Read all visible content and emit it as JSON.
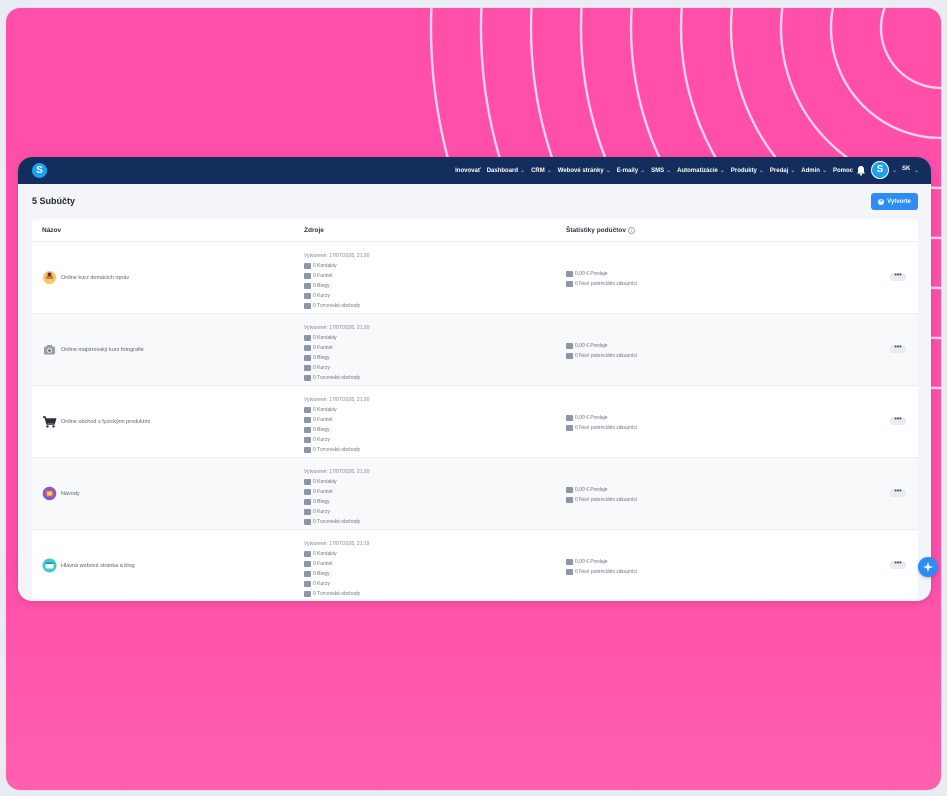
{
  "navbar": {
    "items": [
      {
        "label": "Inovovať",
        "chevron": false
      },
      {
        "label": "Dashboard",
        "chevron": true
      },
      {
        "label": "CRM",
        "chevron": true
      },
      {
        "label": "Webové stránky",
        "chevron": true
      },
      {
        "label": "E-maily",
        "chevron": true
      },
      {
        "label": "SMS",
        "chevron": true
      },
      {
        "label": "Automatizácie",
        "chevron": true
      },
      {
        "label": "Produkty",
        "chevron": true
      },
      {
        "label": "Predaj",
        "chevron": true
      },
      {
        "label": "Admin",
        "chevron": true
      },
      {
        "label": "Pomoc",
        "chevron": false
      }
    ],
    "logo_letter": "S",
    "avatar_letter": "S",
    "language": "SK"
  },
  "page": {
    "title": "5 Subúčty",
    "create_label": "Vytvorte"
  },
  "table": {
    "headers": {
      "name": "Názov",
      "sources": "Zdroje",
      "stats": "Štatistiky podúčtov"
    },
    "rows": [
      {
        "name": "Online kurz domácich opráv",
        "icon": "tools-icon",
        "created": "Vytvorené: 17/07/2026, 21:20",
        "contacts": "0 Kontakty",
        "funnel": "0 Funnel",
        "blogs": "0 Blogy",
        "courses": "0 Kurzy",
        "stores": "0 Tvrcovské obchody",
        "sales": "0,00 € Predaje",
        "leads": "0 Noví potenciálni zákazníci"
      },
      {
        "name": "Online majstrovský kurz fotografie",
        "icon": "camera-icon",
        "created": "Vytvorené: 17/07/2026, 21:20",
        "contacts": "0 Kontakty",
        "funnel": "0 Funnel",
        "blogs": "0 Blogy",
        "courses": "0 Kurzy",
        "stores": "0 Tvrcovské obchody",
        "sales": "0,00 € Predaje",
        "leads": "0 Noví potenciálni zákazníci"
      },
      {
        "name": "Online obchod s fyzickými produktmi",
        "icon": "cart-icon",
        "created": "Vytvorené: 17/07/2026, 21:20",
        "contacts": "0 Kontakty",
        "funnel": "0 Funnel",
        "blogs": "0 Blogy",
        "courses": "0 Kurzy",
        "stores": "0 Tvrcovské obchody",
        "sales": "0,00 € Predaje",
        "leads": "0 Noví potenciálni zákazníci"
      },
      {
        "name": "Návody",
        "icon": "book-icon",
        "created": "Vytvorené: 17/07/2026, 21:20",
        "contacts": "0 Kontakty",
        "funnel": "0 Funnel",
        "blogs": "0 Blogy",
        "courses": "0 Kurzy",
        "stores": "0 Tvrcovské obchody",
        "sales": "0,00 € Predaje",
        "leads": "0 Noví potenciálni zákazníci"
      },
      {
        "name": "Hlavná webová stránka a blog",
        "icon": "website-icon",
        "created": "Vytvorené: 17/07/2026, 21:19",
        "contacts": "0 Kontakty",
        "funnel": "0 Funnel",
        "blogs": "0 Blogy",
        "courses": "0 Kurzy",
        "stores": "0 Tvrcovské obchody",
        "sales": "0,00 € Predaje",
        "leads": "0 Noví potenciálni zákazníci"
      }
    ],
    "more_label": "•••"
  },
  "colors": {
    "background": "#ff4fa8",
    "navbar": "#132d5c",
    "accent": "#2d8df5"
  }
}
